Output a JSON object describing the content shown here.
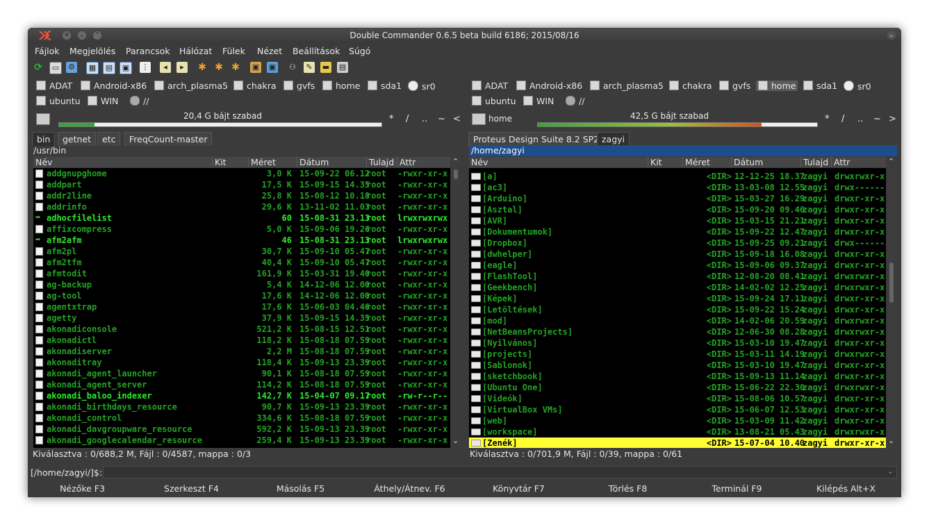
{
  "window": {
    "title": "Double Commander 0.6.5 beta build 6186; 2015/08/16"
  },
  "menu": [
    "Fájlok",
    "Megjelölés",
    "Parancsok",
    "Hálózat",
    "Fülek",
    "Nézet",
    "Beállítások",
    "Súgó"
  ],
  "drives_row1": [
    "ADAT",
    "Android-x86",
    "arch_plasma5",
    "chakra",
    "gvfs",
    "home",
    "sda1",
    "sr0"
  ],
  "drives_row2": [
    "ubuntu",
    "WIN",
    "//"
  ],
  "left": {
    "free": "20,4 G bájt szabad",
    "free_fraction": 0.11,
    "tabs": [
      "bin",
      "getnet",
      "etc",
      "FreqCount-master"
    ],
    "path": "/usr/bin",
    "columns": [
      "Név",
      "Kit",
      "Méret",
      "Dátum",
      "Tulajd",
      "Attr"
    ],
    "rows": [
      {
        "name": "addgnupghome",
        "size": "3,0 K",
        "date": "15-09-22 06.12",
        "owner": "root",
        "attr": "-rwxr-xr-x"
      },
      {
        "name": "addpart",
        "size": "17,5 K",
        "date": "15-09-15 14.35",
        "owner": "root",
        "attr": "-rwxr-xr-x"
      },
      {
        "name": "addr2line",
        "size": "25,8 K",
        "date": "15-08-12 10.18",
        "owner": "root",
        "attr": "-rwxr-xr-x"
      },
      {
        "name": "addrinfo",
        "size": "29,6 K",
        "date": "13-11-02 11.03",
        "owner": "root",
        "attr": "-rwxr-xr-x"
      },
      {
        "name": "adhocfilelist",
        "size": "60",
        "date": "15-08-31 23.13",
        "owner": "root",
        "attr": "lrwxrwxrwx",
        "link": true
      },
      {
        "name": "affixcompress",
        "size": "5,0 K",
        "date": "15-09-06 19.26",
        "owner": "root",
        "attr": "-rwxr-xr-x"
      },
      {
        "name": "afm2afm",
        "size": "46",
        "date": "15-08-31 23.13",
        "owner": "root",
        "attr": "lrwxrwxrwx",
        "link": true
      },
      {
        "name": "afm2pl",
        "size": "30,7 K",
        "date": "15-09-10 05.47",
        "owner": "root",
        "attr": "-rwxr-xr-x"
      },
      {
        "name": "afm2tfm",
        "size": "40,4 K",
        "date": "15-09-10 05.47",
        "owner": "root",
        "attr": "-rwxr-xr-x"
      },
      {
        "name": "afmtodit",
        "size": "161,9 K",
        "date": "15-03-31 19.40",
        "owner": "root",
        "attr": "-rwxr-xr-x"
      },
      {
        "name": "ag-backup",
        "size": "5,4 K",
        "date": "14-12-06 12.00",
        "owner": "root",
        "attr": "-rwxr-xr-x"
      },
      {
        "name": "ag-tool",
        "size": "17,6 K",
        "date": "14-12-06 12.00",
        "owner": "root",
        "attr": "-rwxr-xr-x"
      },
      {
        "name": "agentxtrap",
        "size": "17,6 K",
        "date": "15-06-03 04.46",
        "owner": "root",
        "attr": "-rwxr-xr-x"
      },
      {
        "name": "agetty",
        "size": "37,9 K",
        "date": "15-09-15 14.35",
        "owner": "root",
        "attr": "-rwxr-xr-x"
      },
      {
        "name": "akonadiconsole",
        "size": "521,2 K",
        "date": "15-08-15 12.51",
        "owner": "root",
        "attr": "-rwxr-xr-x"
      },
      {
        "name": "akonadictl",
        "size": "118,2 K",
        "date": "15-08-18 07.59",
        "owner": "root",
        "attr": "-rwxr-xr-x"
      },
      {
        "name": "akonadiserver",
        "size": "2,2 M",
        "date": "15-08-18 07.59",
        "owner": "root",
        "attr": "-rwxr-xr-x"
      },
      {
        "name": "akonaditray",
        "size": "118,4 K",
        "date": "15-09-13 23.39",
        "owner": "root",
        "attr": "-rwxr-xr-x"
      },
      {
        "name": "akonadi_agent_launcher",
        "size": "90,1 K",
        "date": "15-08-18 07.59",
        "owner": "root",
        "attr": "-rwxr-xr-x"
      },
      {
        "name": "akonadi_agent_server",
        "size": "114,2 K",
        "date": "15-08-18 07.59",
        "owner": "root",
        "attr": "-rwxr-xr-x"
      },
      {
        "name": "akonadi_baloo_indexer",
        "size": "142,7 K",
        "date": "15-04-07 09.17",
        "owner": "root",
        "attr": "-rw-r--r--",
        "bright": true
      },
      {
        "name": "akonadi_birthdays_resource",
        "size": "90,7 K",
        "date": "15-09-13 23.39",
        "owner": "root",
        "attr": "-rwxr-xr-x"
      },
      {
        "name": "akonadi_control",
        "size": "334,6 K",
        "date": "15-08-18 07.59",
        "owner": "root",
        "attr": "-rwxr-xr-x"
      },
      {
        "name": "akonadi_davgroupware_resource",
        "size": "592,2 K",
        "date": "15-09-13 23.39",
        "owner": "root",
        "attr": "-rwxr-xr-x"
      },
      {
        "name": "akonadi_googlecalendar_resource",
        "size": "259,4 K",
        "date": "15-09-13 23.39",
        "owner": "root",
        "attr": "-rwxr-xr-x"
      }
    ],
    "status": "Kiválasztva : 0/688,2 M, Fájl : 0/4587, mappa : 0/3"
  },
  "right": {
    "drive_label": "home",
    "free": "42,5 G bájt szabad",
    "free_fraction": 0.8,
    "tabs": [
      "Proteus Design Suite 8.2 SP2",
      "zagyi"
    ],
    "path": "/home/zagyi",
    "columns": [
      "Név",
      "Kit",
      "Méret",
      "Dátum",
      "Tulajd",
      "Attr"
    ],
    "rows": [
      {
        "name": "[a]",
        "size": "<DIR>",
        "date": "12-12-25 18.37",
        "owner": "zagyi",
        "attr": "drwxrwxr-x"
      },
      {
        "name": "[ac3]",
        "size": "<DIR>",
        "date": "13-03-08 12.55",
        "owner": "zagyi",
        "attr": "drwx------"
      },
      {
        "name": "[Arduino]",
        "size": "<DIR>",
        "date": "15-03-27 16.29",
        "owner": "zagyi",
        "attr": "drwxr-xr-x"
      },
      {
        "name": "[Asztal]",
        "size": "<DIR>",
        "date": "15-09-20 09.46",
        "owner": "zagyi",
        "attr": "drwxr-xr-x"
      },
      {
        "name": "[AVR]",
        "size": "<DIR>",
        "date": "15-03-15 21.21",
        "owner": "zagyi",
        "attr": "drwxr-xr-x"
      },
      {
        "name": "[Dokumentumok]",
        "size": "<DIR>",
        "date": "15-09-22 12.47",
        "owner": "zagyi",
        "attr": "drwxr-xr-x"
      },
      {
        "name": "[Dropbox]",
        "size": "<DIR>",
        "date": "15-09-25 09.21",
        "owner": "zagyi",
        "attr": "drwx------"
      },
      {
        "name": "[dwhelper]",
        "size": "<DIR>",
        "date": "15-09-18 16.08",
        "owner": "zagyi",
        "attr": "drwxr-xr-x"
      },
      {
        "name": "[eagle]",
        "size": "<DIR>",
        "date": "15-09-06 09.37",
        "owner": "zagyi",
        "attr": "drwxr-xr-x"
      },
      {
        "name": "[FlashTool]",
        "size": "<DIR>",
        "date": "12-08-20 08.41",
        "owner": "zagyi",
        "attr": "drwxrwxr-x"
      },
      {
        "name": "[Geekbench]",
        "size": "<DIR>",
        "date": "14-02-02 12.25",
        "owner": "zagyi",
        "attr": "drwxrwxr-x"
      },
      {
        "name": "[Képek]",
        "size": "<DIR>",
        "date": "15-09-24 17.11",
        "owner": "zagyi",
        "attr": "drwxr-xr-x"
      },
      {
        "name": "[Letöltések]",
        "size": "<DIR>",
        "date": "15-09-22 15.24",
        "owner": "zagyi",
        "attr": "drwxr-xr-x"
      },
      {
        "name": "[mod]",
        "size": "<DIR>",
        "date": "14-02-06 20.59",
        "owner": "zagyi",
        "attr": "drwxrwxr-x"
      },
      {
        "name": "[NetBeansProjects]",
        "size": "<DIR>",
        "date": "12-06-30 08.28",
        "owner": "zagyi",
        "attr": "drwxrwxr-x"
      },
      {
        "name": "[Nyilvános]",
        "size": "<DIR>",
        "date": "15-03-10 19.47",
        "owner": "zagyi",
        "attr": "drwxr-xr-x"
      },
      {
        "name": "[projects]",
        "size": "<DIR>",
        "date": "15-03-11 14.19",
        "owner": "zagyi",
        "attr": "drwxrwxr-x"
      },
      {
        "name": "[Sablonok]",
        "size": "<DIR>",
        "date": "15-03-10 19.47",
        "owner": "zagyi",
        "attr": "drwxr-xr-x"
      },
      {
        "name": "[sketchbook]",
        "size": "<DIR>",
        "date": "15-09-13 11.14",
        "owner": "zagyi",
        "attr": "drwxr-xr-x"
      },
      {
        "name": "[Ubuntu One]",
        "size": "<DIR>",
        "date": "15-06-22 22.30",
        "owner": "zagyi",
        "attr": "drwxrwxr-x"
      },
      {
        "name": "[Videók]",
        "size": "<DIR>",
        "date": "15-08-06 10.57",
        "owner": "zagyi",
        "attr": "drwxr-xr-x"
      },
      {
        "name": "[VirtualBox VMs]",
        "size": "<DIR>",
        "date": "15-06-07 12.53",
        "owner": "zagyi",
        "attr": "drwxr-xr-x"
      },
      {
        "name": "[web]",
        "size": "<DIR>",
        "date": "15-03-09 11.42",
        "owner": "zagyi",
        "attr": "drwxr-xr-x"
      },
      {
        "name": "[workspace]",
        "size": "<DIR>",
        "date": "13-08-21 05.43",
        "owner": "zagyi",
        "attr": "drwxrwxr-x"
      },
      {
        "name": "[Zenék]",
        "size": "<DIR>",
        "date": "15-07-04 10.40",
        "owner": "zagyi",
        "attr": "drwxr-xr-x",
        "cursor": true
      }
    ],
    "status": "Kiválasztva : 0/701,9 M, Fájl : 0/39, mappa : 0/61"
  },
  "cmdline": {
    "prompt": "[/home/zagyi/]$:",
    "value": ""
  },
  "fkeys": [
    "Nézőke F3",
    "Szerkeszt F4",
    "Másolás F5",
    "Áthely/Átnev. F6",
    "Könyvtár F7",
    "Törlés F8",
    "Terminál F9",
    "Kilépés Alt+X"
  ],
  "colors": {
    "file": "#24a324",
    "exec": "#2eea2e",
    "cursor": "#ffff33",
    "path_active": "#1e4d8c",
    "list_bg": "#000000",
    "free_left": "#3ba43b",
    "free_right_start": "#3ba43b",
    "free_right_end": "#d9501e"
  }
}
